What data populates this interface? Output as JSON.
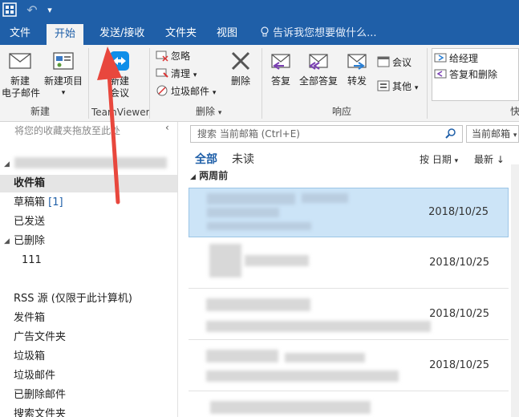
{
  "titlebar": {
    "undo_glyph": "↶",
    "qat_glyph": "▾"
  },
  "tabs": [
    {
      "label": "文件"
    },
    {
      "label": "开始"
    },
    {
      "label": "发送/接收"
    },
    {
      "label": "文件夹"
    },
    {
      "label": "视图"
    }
  ],
  "tellme": "告诉我您想要做什么...",
  "ribbon": {
    "new_group": {
      "label": "新建",
      "new_email": "新建\n电子邮件",
      "new_items": "新建项目"
    },
    "teamviewer_group": {
      "label": "TeamViewer",
      "new_meeting": "新建\n会议"
    },
    "delete_group": {
      "label": "删除",
      "ignore": "忽略",
      "clean": "清理",
      "junk": "垃圾邮件",
      "delete": "删除"
    },
    "respond_group": {
      "label": "响应",
      "reply": "答复",
      "reply_all": "全部答复",
      "forward": "转发",
      "meeting": "会议",
      "more": "其他"
    },
    "quick_steps": {
      "label": "快",
      "to_manager": "给经理",
      "reply_delete": "答复和删除"
    }
  },
  "leftpane": {
    "fav_hint": "将您的收藏夹拖放至此处",
    "folders": [
      {
        "label": "收件箱"
      },
      {
        "label": "草稿箱",
        "count": "[1]"
      },
      {
        "label": "已发送"
      },
      {
        "label": "已删除"
      },
      {
        "label": "111"
      },
      {
        "label": "RSS 源 (仅限于此计算机)"
      },
      {
        "label": "发件箱"
      },
      {
        "label": "广告文件夹"
      },
      {
        "label": "垃圾箱"
      },
      {
        "label": "垃圾邮件"
      },
      {
        "label": "已删除邮件"
      },
      {
        "label": "搜索文件夹"
      }
    ]
  },
  "mail": {
    "search_placeholder": "搜索 当前邮箱 (Ctrl+E)",
    "scope": "当前邮箱",
    "filter_all": "全部",
    "filter_unread": "未读",
    "sort": "按 日期",
    "order": "最新 ↓",
    "group_header": "两周前",
    "rows": [
      {
        "date": "2018/10/25"
      },
      {
        "date": "2018/10/25"
      },
      {
        "date": "2018/10/25"
      },
      {
        "date": "2018/10/25"
      }
    ]
  },
  "colors": {
    "brand": "#1f5fa8",
    "arrow": "#e8473d",
    "selected_row": "#cce4f7"
  }
}
